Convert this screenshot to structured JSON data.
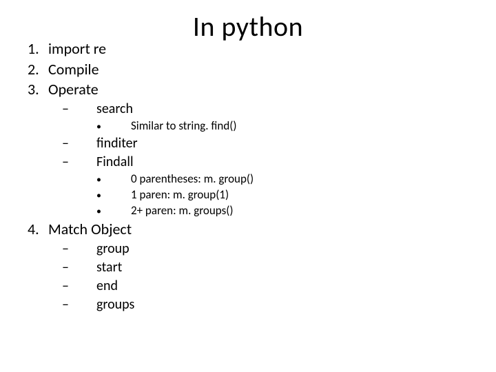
{
  "title": "In python",
  "items": [
    {
      "num": "1.",
      "text": "import re"
    },
    {
      "num": "2.",
      "text": "Compile"
    },
    {
      "num": "3.",
      "text": "Operate",
      "sub": [
        {
          "bullet": "–",
          "text": "search",
          "sub": [
            {
              "bullet": "•",
              "text": "Similar to string. find()"
            }
          ]
        },
        {
          "bullet": "–",
          "text": "finditer"
        },
        {
          "bullet": "–",
          "text": "Findall",
          "sub": [
            {
              "bullet": "•",
              "text": "0 parentheses: m. group()"
            },
            {
              "bullet": "•",
              "text": "1 paren: m. group(1)"
            },
            {
              "bullet": "•",
              "text": "2+ paren: m. groups()"
            }
          ]
        }
      ]
    },
    {
      "num": "4.",
      "text": "Match Object",
      "sub": [
        {
          "bullet": "–",
          "text": "group"
        },
        {
          "bullet": "–",
          "text": "start"
        },
        {
          "bullet": "–",
          "text": "end"
        },
        {
          "bullet": "–",
          "text": "groups"
        }
      ]
    }
  ]
}
